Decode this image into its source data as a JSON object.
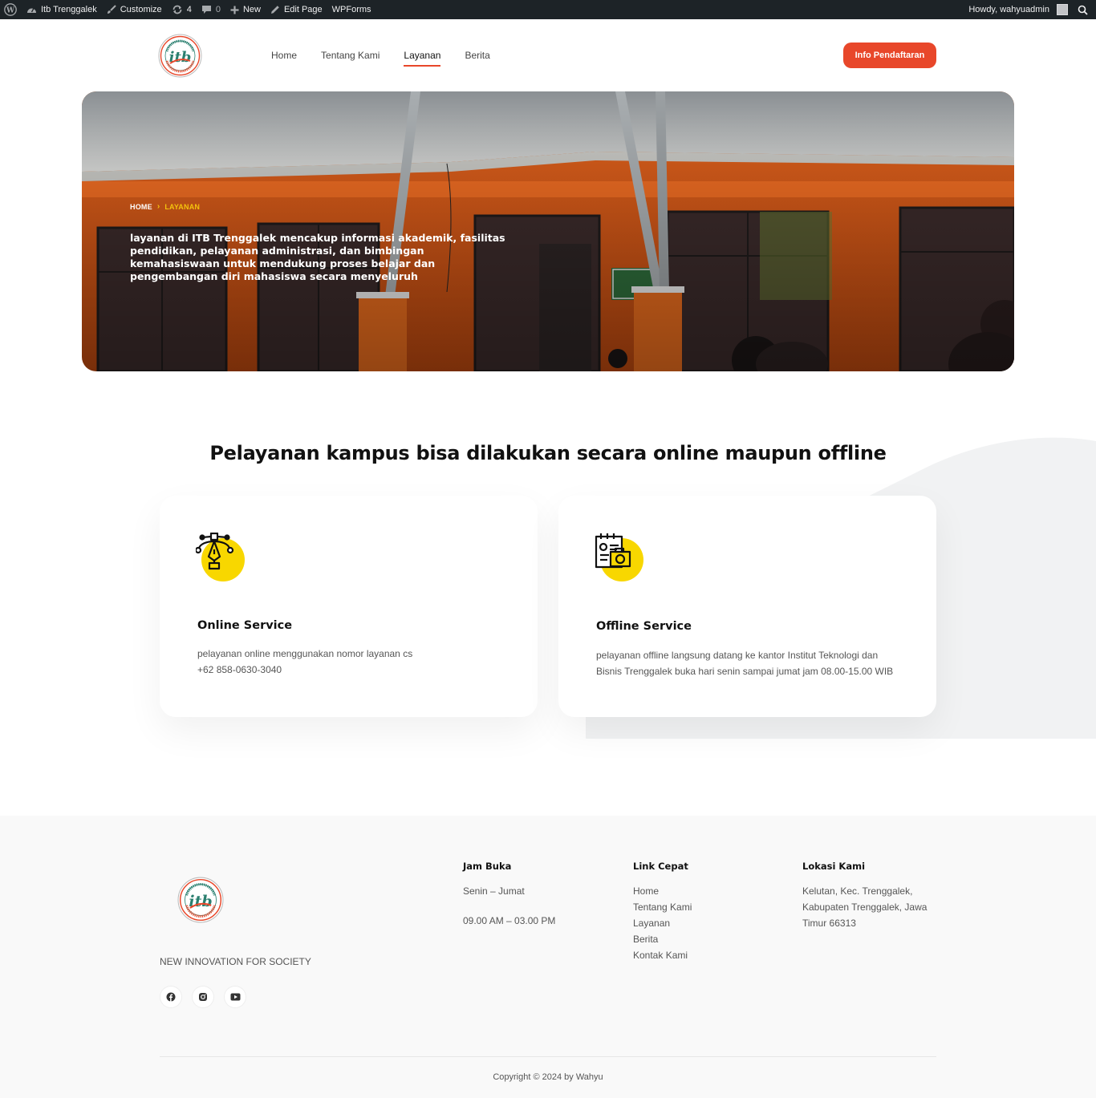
{
  "admin_bar": {
    "site_name": "Itb Trenggalek",
    "customize": "Customize",
    "updates_count": "4",
    "comments_count": "0",
    "new": "New",
    "edit_page": "Edit Page",
    "wpforms": "WPForms",
    "howdy": "Howdy, wahyuadmin"
  },
  "header": {
    "nav": [
      "Home",
      "Tentang Kami",
      "Layanan",
      "Berita"
    ],
    "active_nav": "Layanan",
    "cta_label": "Info Pendaftaran"
  },
  "hero": {
    "breadcrumb_home": "HOME",
    "breadcrumb_current": "LAYANAN",
    "text": "layanan di ITB Trenggalek mencakup informasi akademik, fasilitas pendidikan, pelayanan administrasi, dan bimbingan kemahasiswaan untuk mendukung proses belajar dan pengembangan diri mahasiswa secara menyeluruh"
  },
  "services": {
    "title": "Pelayanan kampus bisa dilakukan secara online maupun offline",
    "cards": [
      {
        "icon": "pen-tool-icon",
        "title": "Online Service",
        "line1": "pelayanan online menggunakan nomor layanan cs",
        "line2": "+62 858-0630-3040"
      },
      {
        "icon": "calendar-camera-icon",
        "title": "Offline Service",
        "line1": "pelayanan offline langsung datang ke kantor Institut Teknologi dan",
        "line2": "Bisnis Trenggalek buka hari senin sampai jumat jam 08.00-15.00 WIB"
      }
    ]
  },
  "footer": {
    "tagline": "NEW INNOVATION FOR SOCIETY",
    "hours": {
      "heading": "Jam Buka",
      "days": "Senin – Jumat",
      "time": "09.00 AM – 03.00 PM"
    },
    "quick_links": {
      "heading": "Link Cepat",
      "items": [
        "Home",
        "Tentang Kami",
        "Layanan",
        "Berita",
        "Kontak Kami"
      ]
    },
    "location": {
      "heading": "Lokasi Kami",
      "lines": [
        "Kelutan, Kec. Trenggalek,",
        "Kabupaten Trenggalek, Jawa",
        "Timur 66313"
      ]
    },
    "copyright": "Copyright © 2024 by Wahyu"
  },
  "colors": {
    "accent": "#e8472a",
    "highlight": "#f4c20d",
    "admin_bar": "#1d2327",
    "footer_bg": "#f9f9f9"
  }
}
